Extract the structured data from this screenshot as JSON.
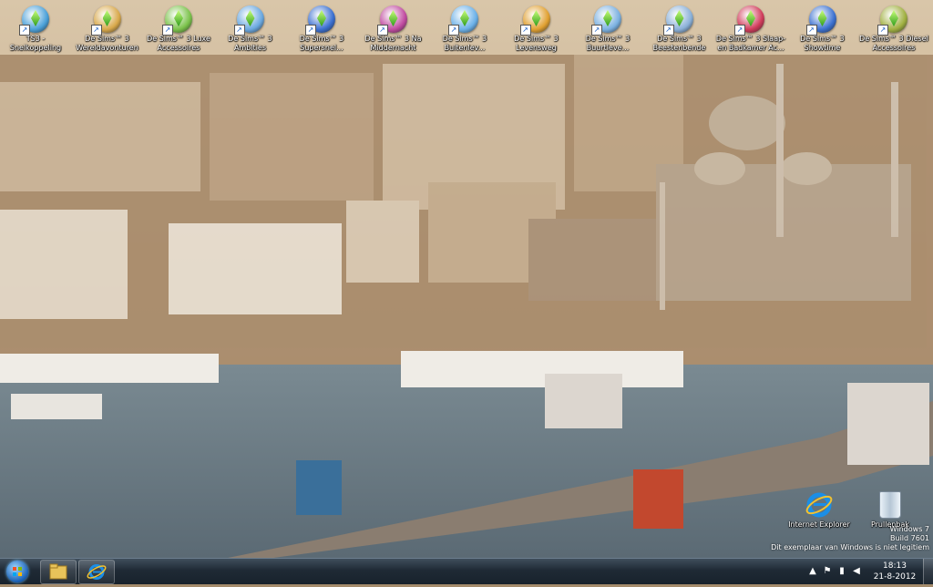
{
  "desktop": {
    "icons_top": [
      {
        "label": "TS3 - Snelkoppeling",
        "color": "#4aa0d8"
      },
      {
        "label": "De Sims™ 3 Wereldavonturen",
        "color": "#d8a84a"
      },
      {
        "label": "De Sims™ 3 Luxe Accessoires",
        "color": "#7ac24a"
      },
      {
        "label": "De Sims™ 3 Ambities",
        "color": "#6aa8e0"
      },
      {
        "label": "De Sims™ 3 Supersnel...",
        "color": "#3a6fd0"
      },
      {
        "label": "De Sims™ 3 Na Middernacht",
        "color": "#c04aa0"
      },
      {
        "label": "De Sims™ 3 Buitenlev...",
        "color": "#6ab0e8"
      },
      {
        "label": "De Sims™ 3 Levensweg",
        "color": "#e0a030"
      },
      {
        "label": "De Sims™ 3 Buurtleve...",
        "color": "#7ab0e0"
      },
      {
        "label": "De Sims™ 3 Beestenbende",
        "color": "#8ab0d8"
      },
      {
        "label": "De Sims™ 3 Slaap- en Badkamer Ac...",
        "color": "#d03a5a"
      },
      {
        "label": "De Sims™ 3 Showtime",
        "color": "#3a70d0"
      },
      {
        "label": "De Sims™ 3 Diesel Accessoires",
        "color": "#a0b040"
      }
    ],
    "ie_label": "Internet Explorer",
    "bin_label": "Prullenbak"
  },
  "watermark": {
    "line1": "Windows 7",
    "line2": "Build 7601",
    "line3": "Dit exemplaar van Windows is niet legitiem"
  },
  "taskbar": {
    "clock_time": "18:13",
    "clock_date": "21-8-2012"
  }
}
